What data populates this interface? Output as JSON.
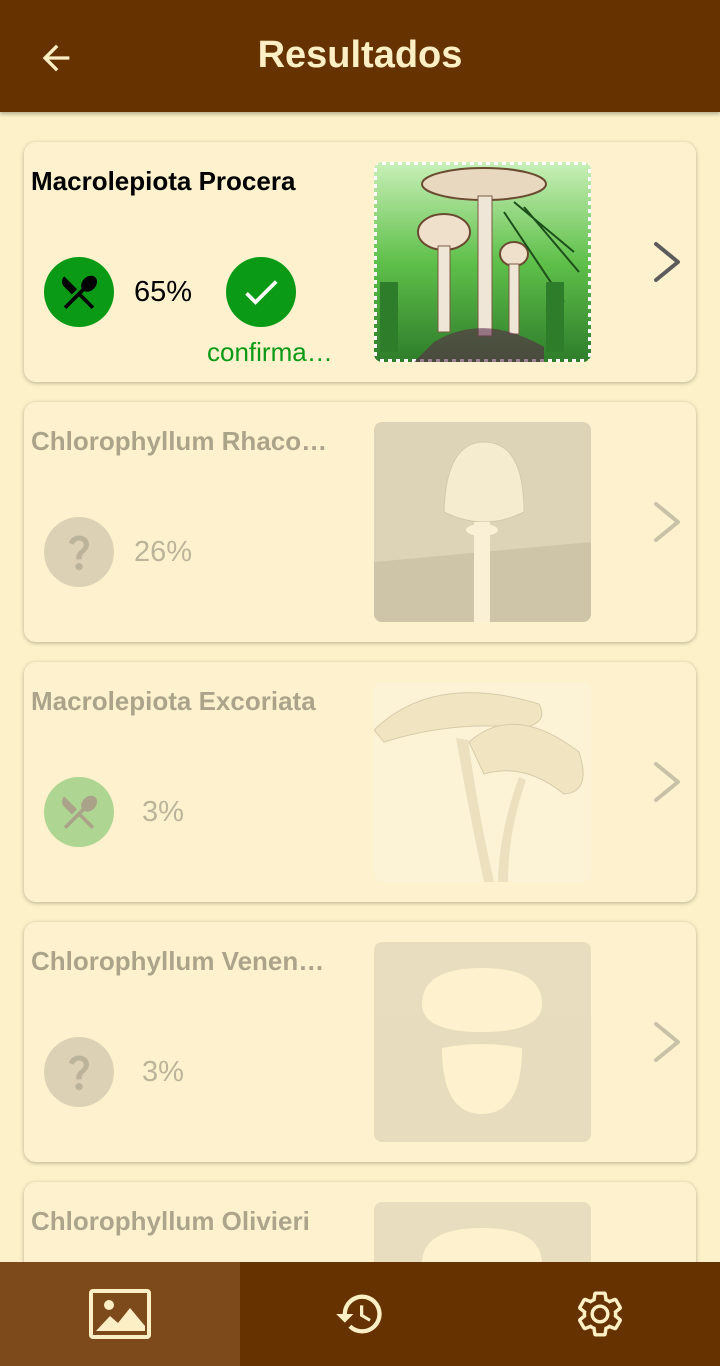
{
  "app_bar": {
    "title": "Resultados",
    "back_icon": "arrow-left-icon"
  },
  "colors": {
    "brand": "#663300",
    "background": "#fcf1c8",
    "edible_green": "#0b9a16",
    "text_light": "#fcefc6"
  },
  "results": [
    {
      "name": "Macrolepiota Procera",
      "percent": "65%",
      "edibility_icon": "edible-icon",
      "confirm_label": "confirma…",
      "image": "stamp-photo",
      "highlighted": true
    },
    {
      "name": "Chlorophyllum Rhaco…",
      "percent": "26%",
      "edibility_icon": "unknown-icon",
      "image": "photo",
      "highlighted": false
    },
    {
      "name": "Macrolepiota Excoriata",
      "percent": "3%",
      "edibility_icon": "edible-icon",
      "image": "photo",
      "highlighted": false
    },
    {
      "name": "Chlorophyllum Venen…",
      "percent": "3%",
      "edibility_icon": "unknown-icon",
      "image": "placeholder-mushroom",
      "highlighted": false
    },
    {
      "name": "Chlorophyllum Olivieri",
      "image": "placeholder-mushroom",
      "highlighted": false
    }
  ],
  "bottom_nav": {
    "items": [
      {
        "icon": "image-icon",
        "active": true
      },
      {
        "icon": "history-icon",
        "active": false
      },
      {
        "icon": "settings-icon",
        "active": false
      }
    ]
  }
}
